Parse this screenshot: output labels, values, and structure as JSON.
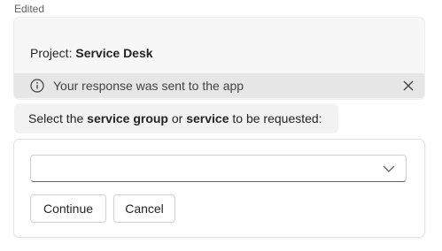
{
  "status": {
    "edited_label": "Edited"
  },
  "card": {
    "project_label": "Project: ",
    "project_name": "Service Desk",
    "notice": {
      "icon": "info-icon",
      "text": "Your response was sent to the app",
      "close_icon": "close-icon"
    }
  },
  "prompt": {
    "part1": "Select the ",
    "bold1": "service group",
    "part2": " or ",
    "bold2": "service",
    "part3": " to be requested:"
  },
  "form": {
    "dropdown": {
      "selected_value": "",
      "icon": "chevron-down-icon"
    },
    "buttons": {
      "continue_label": "Continue",
      "cancel_label": "Cancel"
    }
  }
}
